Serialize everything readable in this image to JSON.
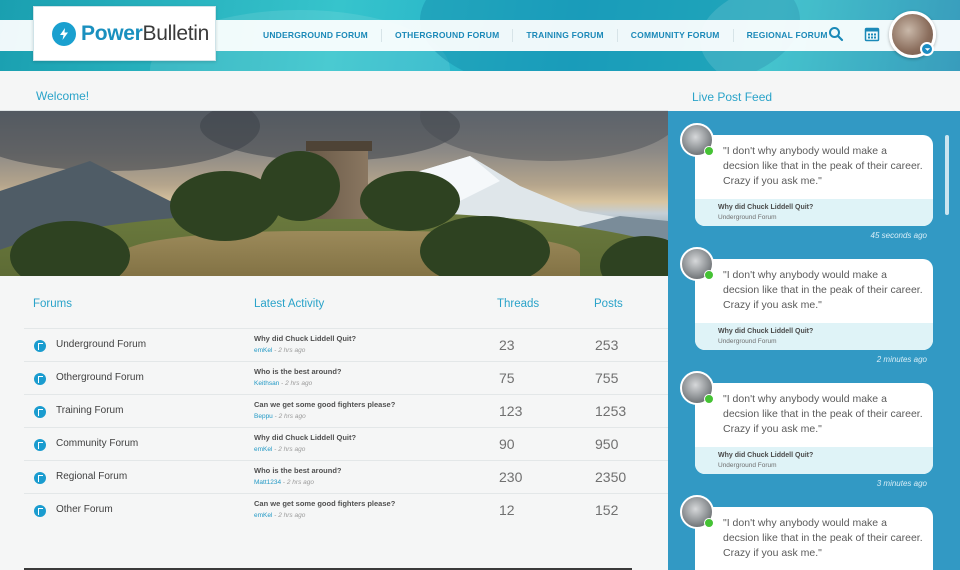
{
  "brand": {
    "name_part1": "Power",
    "name_part2": "Bulletin",
    "accent": "#1a90bf"
  },
  "nav": {
    "items": [
      "Underground Forum",
      "Otherground Forum",
      "Training Forum",
      "Community Forum",
      "Regional Forum"
    ],
    "icons": [
      "search-icon",
      "calendar-icon"
    ]
  },
  "welcome": "Welcome!",
  "forums": {
    "headers": {
      "forums": "Forums",
      "latest": "Latest Activity",
      "threads": "Threads",
      "posts": "Posts"
    },
    "rows": [
      {
        "name": "Underground Forum",
        "title": "Why did Chuck Liddell Quit?",
        "user": "emKel",
        "time": "2 hrs ago",
        "threads": "23",
        "posts": "253"
      },
      {
        "name": "Otherground Forum",
        "title": "Who is the best around?",
        "user": "Keithsan",
        "time": "2 hrs ago",
        "threads": "75",
        "posts": "755"
      },
      {
        "name": "Training Forum",
        "title": "Can we get some good fighters please?",
        "user": "Beppu",
        "time": "2 hrs ago",
        "threads": "123",
        "posts": "1253"
      },
      {
        "name": "Community Forum",
        "title": "Why did Chuck Liddell Quit?",
        "user": "emKel",
        "time": "2 hrs ago",
        "threads": "90",
        "posts": "950"
      },
      {
        "name": "Regional Forum",
        "title": "Who is the best around?",
        "user": "Matt1234",
        "time": "2 hrs ago",
        "threads": "230",
        "posts": "2350"
      },
      {
        "name": "Other Forum",
        "title": "Can we get some good fighters please?",
        "user": "emKel",
        "time": "2 hrs ago",
        "threads": "12",
        "posts": "152"
      }
    ]
  },
  "feed": {
    "title": "Live Post Feed",
    "posts": [
      {
        "quote": "\"I don't why anybody would make a decsion like that in the peak of their career. Crazy if you ask me.\"",
        "thread": "Why did Chuck Liddell Quit?",
        "forum": "Underground Forum",
        "time": "45 seconds ago"
      },
      {
        "quote": "\"I don't why anybody would make a decsion like that in the peak of their career. Crazy if you ask me.\"",
        "thread": "Why did Chuck Liddell Quit?",
        "forum": "Underground Forum",
        "time": "2 minutes ago"
      },
      {
        "quote": "\"I don't why anybody would make a decsion like that in the peak of their career. Crazy if you ask me.\"",
        "thread": "Why did Chuck Liddell Quit?",
        "forum": "Underground Forum",
        "time": "3 minutes ago"
      },
      {
        "quote": "\"I don't why anybody would make a decsion like that in the peak of their career. Crazy if you ask me.\"",
        "thread": "",
        "forum": "",
        "time": ""
      }
    ]
  }
}
